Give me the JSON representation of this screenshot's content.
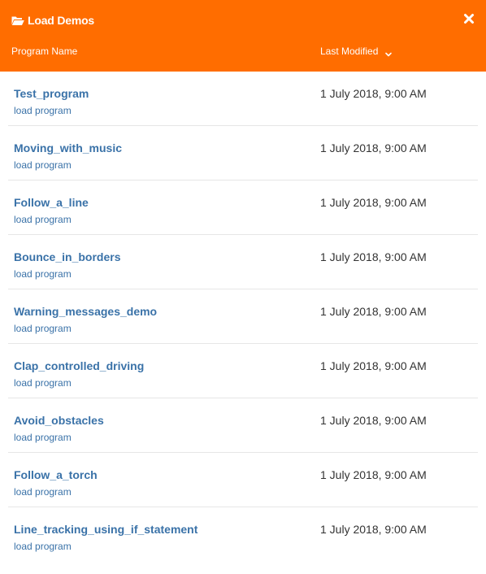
{
  "dialog": {
    "title": "Load Demos",
    "title_icon": "folder-open-icon",
    "close_icon": "close-icon",
    "accent_color": "#ff6d00",
    "link_color": "#3a72a8"
  },
  "columns": {
    "name": "Program Name",
    "modified": "Last Modified",
    "sort_icon": "chevron-down-icon"
  },
  "programs": [
    {
      "name": "Test_program",
      "action": "load program",
      "modified": "1 July 2018, 9:00 AM"
    },
    {
      "name": "Moving_with_music",
      "action": "load program",
      "modified": "1 July 2018, 9:00 AM"
    },
    {
      "name": "Follow_a_line",
      "action": "load program",
      "modified": "1 July 2018, 9:00 AM"
    },
    {
      "name": "Bounce_in_borders",
      "action": "load program",
      "modified": "1 July 2018, 9:00 AM"
    },
    {
      "name": "Warning_messages_demo",
      "action": "load program",
      "modified": "1 July 2018, 9:00 AM"
    },
    {
      "name": "Clap_controlled_driving",
      "action": "load program",
      "modified": "1 July 2018, 9:00 AM"
    },
    {
      "name": "Avoid_obstacles",
      "action": "load program",
      "modified": "1 July 2018, 9:00 AM"
    },
    {
      "name": "Follow_a_torch",
      "action": "load program",
      "modified": "1 July 2018, 9:00 AM"
    },
    {
      "name": "Line_tracking_using_if_statement",
      "action": "load program",
      "modified": "1 July 2018, 9:00 AM"
    }
  ]
}
